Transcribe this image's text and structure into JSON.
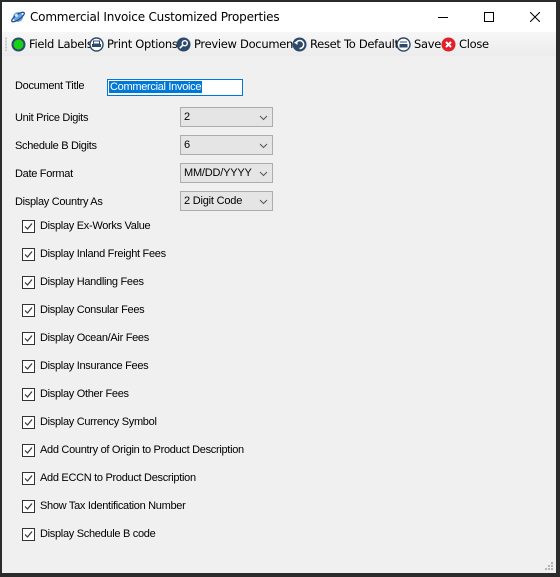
{
  "window": {
    "title": "Commercial Invoice Customized Properties",
    "icon": "invoice-planet-icon",
    "controls": {
      "minimize": "minimize-icon",
      "maximize": "maximize-icon",
      "close": "close-icon"
    }
  },
  "toolbar": {
    "items": [
      {
        "label": "Field Labels",
        "icon": "green-circle-icon"
      },
      {
        "label": "Print Options",
        "icon": "printer-icon"
      },
      {
        "label": "Preview Document",
        "icon": "magnifier-icon"
      },
      {
        "label": "Reset To Defaults",
        "icon": "undo-icon"
      },
      {
        "label": "Save",
        "icon": "save-icon"
      },
      {
        "label": "Close",
        "icon": "close-red-icon"
      }
    ]
  },
  "form": {
    "document_title": {
      "label": "Document Title",
      "value": "Commercial Invoice"
    },
    "unit_price_digits": {
      "label": "Unit Price Digits",
      "value": "2"
    },
    "schedule_b_digits": {
      "label": "Schedule B Digits",
      "value": "6"
    },
    "date_format": {
      "label": "Date Format",
      "value": "MM/DD/YYYY"
    },
    "display_country_as": {
      "label": "Display Country As",
      "value": "2 Digit Code"
    },
    "checkboxes": [
      {
        "label": "Display Ex-Works Value",
        "checked": true
      },
      {
        "label": "Display Inland Freight Fees",
        "checked": true
      },
      {
        "label": "Display Handling Fees",
        "checked": true
      },
      {
        "label": "Display Consular Fees",
        "checked": true
      },
      {
        "label": "Display Ocean/Air Fees",
        "checked": true
      },
      {
        "label": "Display Insurance Fees",
        "checked": true
      },
      {
        "label": "Display Other Fees",
        "checked": true
      },
      {
        "label": "Display Currency Symbol",
        "checked": true
      },
      {
        "label": "Add Country of Origin to Product Description",
        "checked": true
      },
      {
        "label": "Add ECCN to Product Description",
        "checked": true
      },
      {
        "label": "Show Tax Identification Number",
        "checked": true
      },
      {
        "label": "Display Schedule B code",
        "checked": true
      }
    ]
  }
}
